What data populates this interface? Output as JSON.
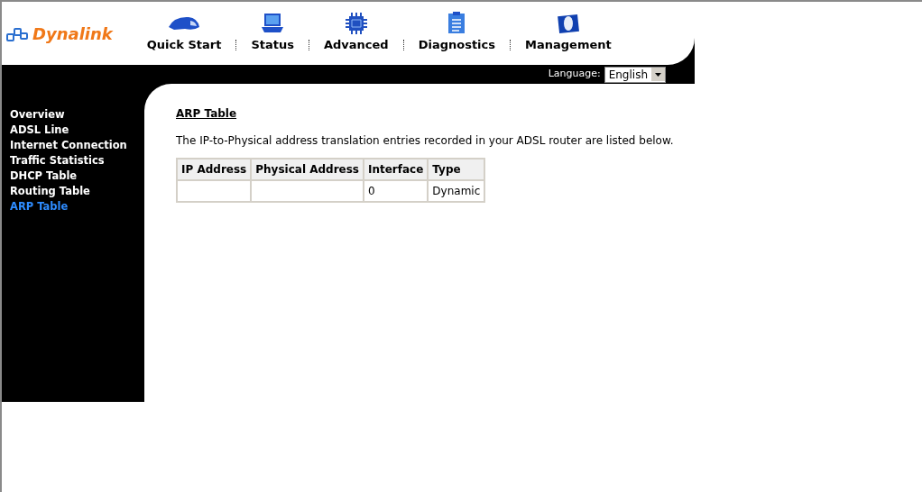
{
  "logo": {
    "text": "Dynalink"
  },
  "nav": [
    {
      "label": "Quick Start",
      "kind": "car"
    },
    {
      "label": "Status",
      "kind": "laptop"
    },
    {
      "label": "Advanced",
      "kind": "chip"
    },
    {
      "label": "Diagnostics",
      "kind": "clipboard"
    },
    {
      "label": "Management",
      "kind": "mouse"
    }
  ],
  "language": {
    "label": "Language:",
    "value": "English"
  },
  "sidebar": {
    "items": [
      {
        "label": "Overview",
        "selected": false
      },
      {
        "label": "ADSL Line",
        "selected": false
      },
      {
        "label": "Internet Connection",
        "selected": false
      },
      {
        "label": "Traffic Statistics",
        "selected": false
      },
      {
        "label": "DHCP Table",
        "selected": false
      },
      {
        "label": "Routing Table",
        "selected": false
      },
      {
        "label": "ARP Table",
        "selected": true
      }
    ]
  },
  "content": {
    "title": "ARP Table",
    "description": "The IP-to-Physical address translation entries recorded in your ADSL router are listed below.",
    "table": {
      "columns": [
        "IP Address",
        "Physical Address",
        "Interface",
        "Type"
      ],
      "rows": [
        {
          "interface": "0",
          "type": "Dynamic"
        }
      ]
    }
  }
}
